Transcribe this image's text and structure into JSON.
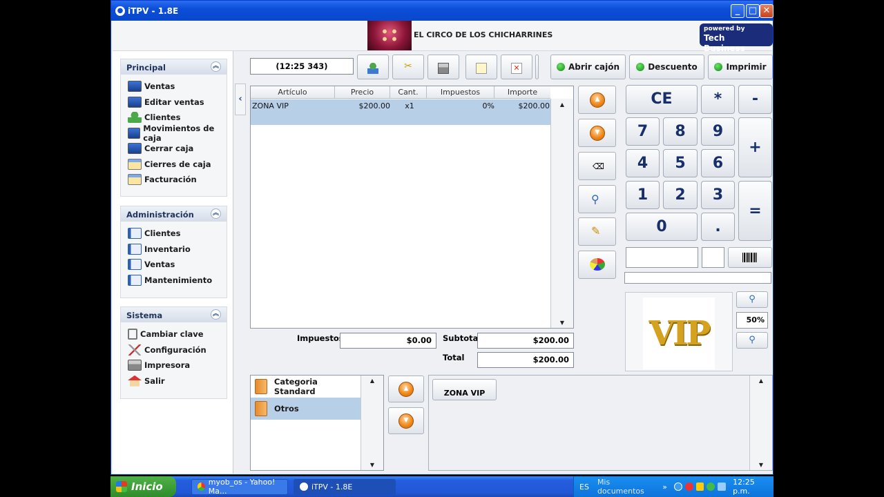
{
  "window": {
    "title": "iTPV - 1.8E"
  },
  "header": {
    "company_name": "EL CIRCO DE LOS CHICHARRINES",
    "powered_line1": "powered by",
    "powered_line2": "Tech Business"
  },
  "sidebar": {
    "sections": [
      {
        "title": "Principal",
        "items": [
          "Ventas",
          "Editar ventas",
          "Clientes",
          "Movimientos de caja",
          "Cerrar caja",
          "Cierres de caja",
          "Facturación"
        ]
      },
      {
        "title": "Administración",
        "items": [
          "Clientes",
          "Inventario",
          "Ventas",
          "Mantenimiento"
        ]
      },
      {
        "title": "Sistema",
        "items": [
          "Cambiar clave",
          "Configuración",
          "Impresora",
          "Salir"
        ]
      }
    ]
  },
  "toolbar": {
    "ticket_id": "(12:25 343)",
    "open_drawer": "Abrir cajón",
    "discount": "Descuento",
    "print": "Imprimir"
  },
  "ticket": {
    "columns": [
      "Artículo",
      "Precio",
      "Cant.",
      "Impuestos",
      "Importe"
    ],
    "rows": [
      {
        "article": "ZONA VIP",
        "price": "$200.00",
        "qty": "x1",
        "tax": "0%",
        "amount": "$200.00"
      }
    ]
  },
  "totals": {
    "tax_label": "Impuestos",
    "tax_value": "$0.00",
    "subtotal_label": "Subtotal",
    "subtotal_value": "$200.00",
    "total_label": "Total",
    "total_value": "$200.00"
  },
  "keypad": {
    "ce": "CE",
    "mul": "*",
    "minus": "-",
    "plus": "+",
    "equals": "=",
    "k7": "7",
    "k8": "8",
    "k9": "9",
    "k4": "4",
    "k5": "5",
    "k6": "6",
    "k1": "1",
    "k2": "2",
    "k3": "3",
    "k0": "0",
    "dot": "."
  },
  "zoom": {
    "level": "50%"
  },
  "product_image": {
    "text": "VIP"
  },
  "categories": [
    "Categoria Standard",
    "Otros"
  ],
  "products": [
    "ZONA VIP"
  ],
  "taskbar": {
    "start": "Inicio",
    "tasks": [
      "myob_os - Yahoo! Ma...",
      "iTPV - 1.8E"
    ],
    "lang": "ES",
    "docs": "Mis documentos",
    "clock": "12:25 p.m."
  },
  "colors": {
    "selection": "#b8cfe8",
    "accent_green": "#0a8a0a",
    "key_text": "#18306a"
  }
}
